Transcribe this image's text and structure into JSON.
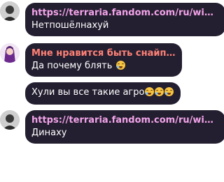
{
  "messages": [
    {
      "header": "https://terraria.fandom.com/ru/wiki/Terraria",
      "text": "Нетпошёлнахуй"
    },
    {
      "header": "Мне нравится быть снайпером",
      "text": "Да почему блять"
    },
    {
      "text": "Хули вы все такие агро"
    },
    {
      "header": "https://terraria.fandom.com/ru/wiki/Terraria",
      "text": "Динаху"
    }
  ],
  "colors": {
    "bubble_bg": "#241f30",
    "link_header": "#f2a3e9",
    "name_header": "#ff8277",
    "text": "#ffffff"
  },
  "icons": {
    "emoji": "crying-laughing-emoji"
  }
}
